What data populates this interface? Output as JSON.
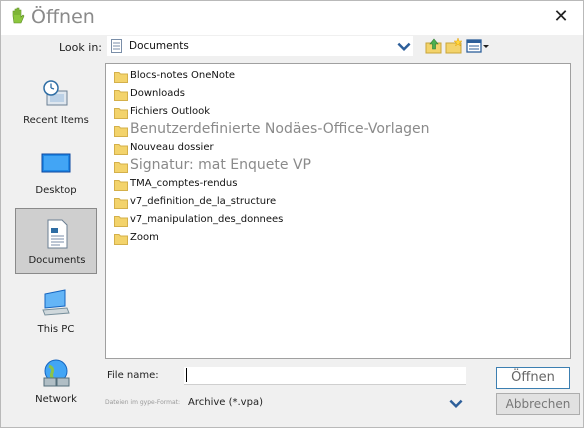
{
  "window": {
    "title": "Öffnen",
    "close_glyph": "✕"
  },
  "look_in": {
    "label": "Look in:",
    "value": "Documents"
  },
  "toolbar": {
    "up_icon": "up-folder-icon",
    "new_folder_icon": "new-folder-icon",
    "view_menu_icon": "view-menu-icon"
  },
  "places": [
    {
      "label": "Recent Items",
      "icon": "recent-items-icon"
    },
    {
      "label": "Desktop",
      "icon": "desktop-icon"
    },
    {
      "label": "Documents",
      "icon": "documents-icon",
      "selected": true
    },
    {
      "label": "This PC",
      "icon": "computer-icon"
    },
    {
      "label": "Network",
      "icon": "network-icon"
    }
  ],
  "files": [
    {
      "label": "Blocs-notes OneNote"
    },
    {
      "label": "Downloads"
    },
    {
      "label": "Fichiers Outlook"
    },
    {
      "label": "Benutzerdefinierte Nodäes-Office-Vorlagen"
    },
    {
      "label": "Nouveau dossier"
    },
    {
      "label": "Signatur: mat Enquete VP"
    },
    {
      "label": "TMA_comptes-rendus"
    },
    {
      "label": "v7_definition_de_la_structure"
    },
    {
      "label": "v7_manipulation_des_donnees"
    },
    {
      "label": "Zoom"
    }
  ],
  "file_name": {
    "label": "File name:",
    "value": ""
  },
  "file_type": {
    "label": "Dateien im gype-Format:",
    "value": "Archive (*.vpa)"
  },
  "buttons": {
    "open": "Öffnen",
    "cancel": "Abbrechen"
  },
  "colors": {
    "folder": "#f3d36b",
    "accent": "#3c7fb1",
    "selection": "#cfcfcf"
  }
}
